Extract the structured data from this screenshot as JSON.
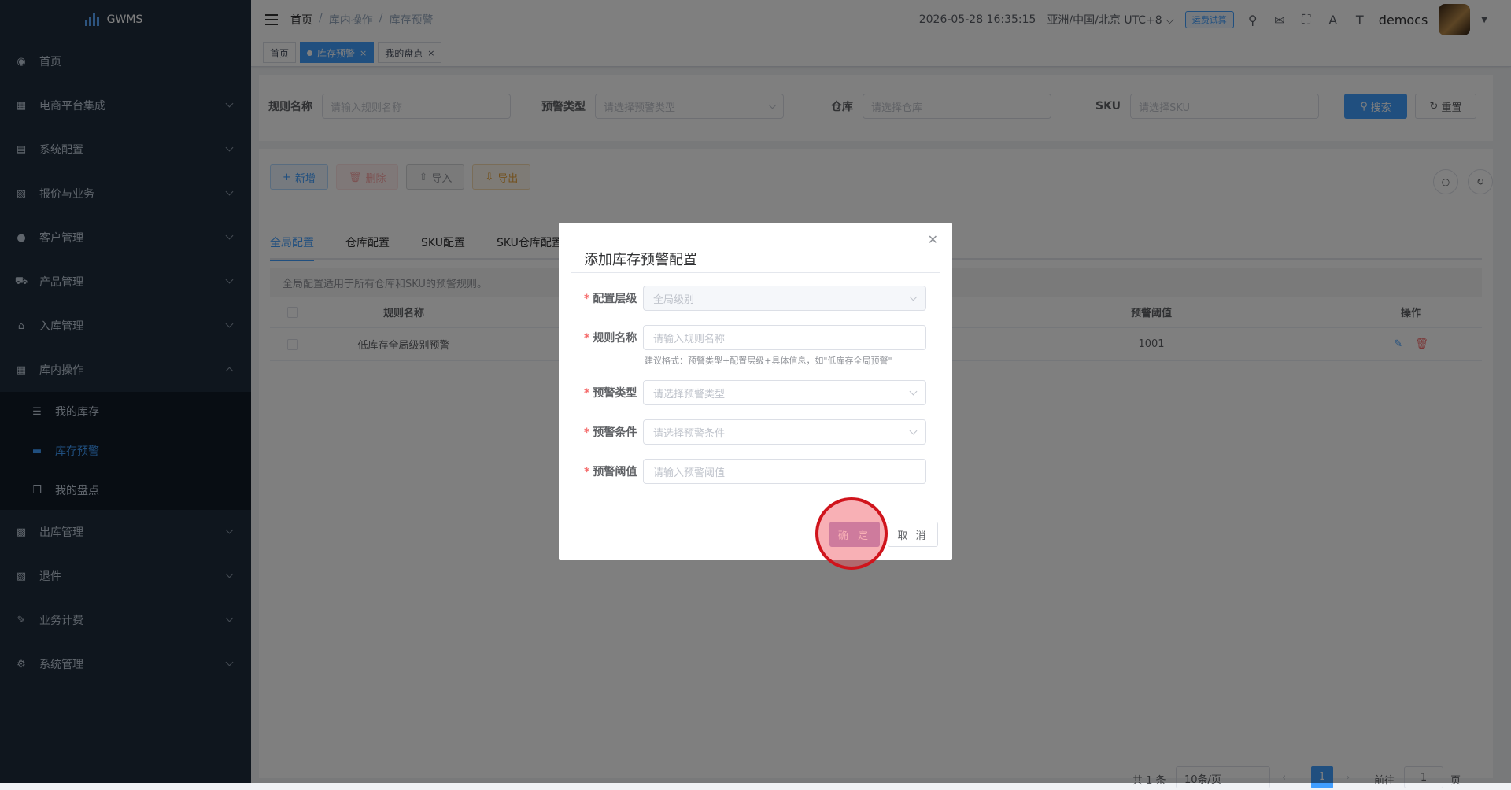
{
  "app": {
    "logo_text": "GWMS"
  },
  "sidebar": {
    "items": [
      {
        "label": "首页",
        "icon": "dashboard-icon"
      },
      {
        "label": "电商平台集成",
        "icon": "bank-icon"
      },
      {
        "label": "系统配置",
        "icon": "config-icon"
      },
      {
        "label": "报价与业务",
        "icon": "quote-icon"
      },
      {
        "label": "客户管理",
        "icon": "user-icon"
      },
      {
        "label": "产品管理",
        "icon": "cart-icon"
      },
      {
        "label": "入库管理",
        "icon": "home-icon"
      },
      {
        "label": "库内操作",
        "icon": "grid-icon"
      },
      {
        "label": "出库管理",
        "icon": "apps-icon"
      },
      {
        "label": "退件",
        "icon": "return-icon"
      },
      {
        "label": "业务计费",
        "icon": "billing-icon"
      },
      {
        "label": "系统管理",
        "icon": "gear-icon"
      }
    ],
    "submenu": [
      {
        "label": "我的库存",
        "icon": "list-icon"
      },
      {
        "label": "库存预警",
        "icon": "message-icon"
      },
      {
        "label": "我的盘点",
        "icon": "copy-icon"
      }
    ]
  },
  "navbar": {
    "breadcrumb": [
      "首页",
      "库内操作",
      "库存预警"
    ],
    "datetime": "2026-05-28 16:35:15",
    "timezone": "亚洲/中国/北京 UTC+8",
    "trial_button": "运费试算",
    "username": "democs"
  },
  "tags": [
    {
      "label": "首页"
    },
    {
      "label": "库存预警"
    },
    {
      "label": "我的盘点"
    }
  ],
  "search": {
    "rule_name_label": "规则名称",
    "rule_name_placeholder": "请输入规则名称",
    "warn_type_label": "预警类型",
    "warn_type_placeholder": "请选择预警类型",
    "warehouse_label": "仓库",
    "warehouse_placeholder": "请选择仓库",
    "sku_label": "SKU",
    "sku_placeholder": "请选择SKU",
    "search_button": "搜索",
    "reset_button": "重置"
  },
  "toolbar": {
    "add": "新增",
    "delete": "删除",
    "import": "导入",
    "export": "导出"
  },
  "tabs": [
    "全局配置",
    "仓库配置",
    "SKU配置",
    "SKU仓库配置"
  ],
  "notice": "全局配置适用于所有仓库和SKU的预警规则。",
  "table": {
    "columns": [
      "规则名称",
      "预警阈值",
      "操作"
    ],
    "rows": [
      {
        "rule_name": "低库存全局级别预警",
        "threshold": "1001"
      }
    ]
  },
  "pagination": {
    "total": "共 1 条",
    "page_size": "10条/页",
    "current_page": "1",
    "goto_label": "前往",
    "goto_value": "1",
    "page_suffix": "页"
  },
  "dialog": {
    "title": "添加库存预警配置",
    "fields": [
      {
        "label": "配置层级",
        "value": "全局级别"
      },
      {
        "label": "规则名称",
        "placeholder": "请输入规则名称"
      },
      {
        "label": "预警类型",
        "placeholder": "请选择预警类型"
      },
      {
        "label": "预警条件",
        "placeholder": "请选择预警条件"
      },
      {
        "label": "预警阈值",
        "placeholder": "请输入预警阈值"
      }
    ],
    "hint": "建议格式：预警类型+配置层级+具体信息，如\"低库存全局预警\"",
    "ok_button": "确 定",
    "cancel_button": "取 消"
  }
}
